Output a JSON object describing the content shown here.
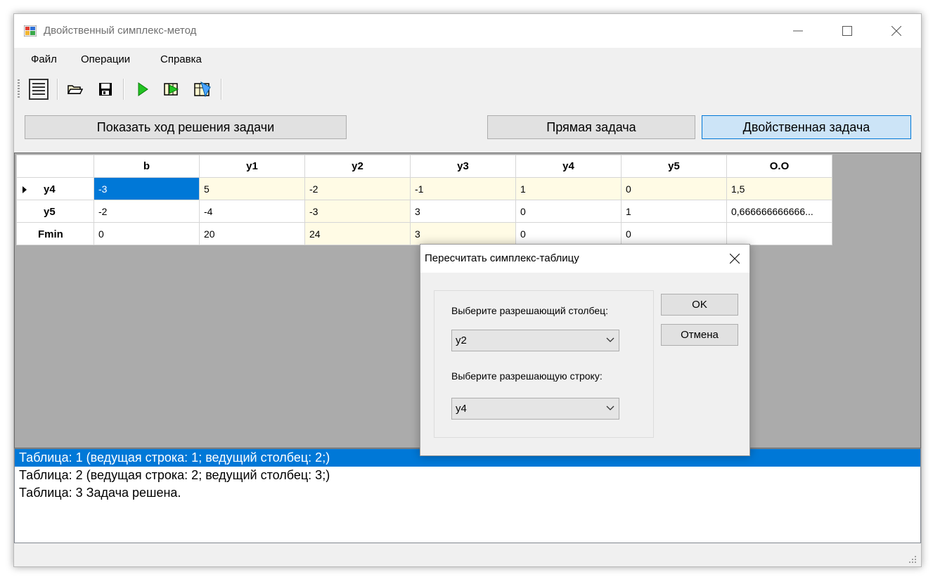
{
  "window": {
    "title": "Двойственный симплекс-метод"
  },
  "menu": [
    "Файл",
    "Операции",
    "Справка"
  ],
  "toolbar": {
    "icons": [
      "new-table-icon",
      "open-folder-icon",
      "save-icon",
      "run-icon",
      "step-icon",
      "auto-solve-icon"
    ]
  },
  "buttons": {
    "show_progress": "Показать ход решения задачи",
    "primal": "Прямая задача",
    "dual": "Двойственная задача"
  },
  "table": {
    "headers": [
      "b",
      "y1",
      "y2",
      "y3",
      "y4",
      "y5",
      "O.O"
    ],
    "rows": [
      {
        "label": "y4",
        "cells": [
          "-3",
          "5",
          "-2",
          "-1",
          "1",
          "0",
          "1,5"
        ]
      },
      {
        "label": "y5",
        "cells": [
          "-2",
          "-4",
          "-3",
          "3",
          "0",
          "1",
          "0,666666666666..."
        ]
      },
      {
        "label": "Fmin",
        "cells": [
          "0",
          "20",
          "24",
          "3",
          "0",
          "0",
          ""
        ]
      }
    ]
  },
  "log": [
    "Таблица: 1 (ведущая строка: 1; ведущий столбец: 2;)",
    "Таблица: 2 (ведущая строка: 2; ведущий столбец: 3;)",
    "Таблица: 3 Задача решена."
  ],
  "dialog": {
    "title": "Пересчитать симплекс-таблицу",
    "column_label": "Выберите разрешающий столбец:",
    "column_value": "y2",
    "row_label": "Выберите разрешающую строку:",
    "row_value": "y4",
    "ok": "OK",
    "cancel": "Отмена"
  },
  "colors": {
    "accent": "#0078d7",
    "highlight": "#fffbe5",
    "grid_bg": "#ababab"
  }
}
